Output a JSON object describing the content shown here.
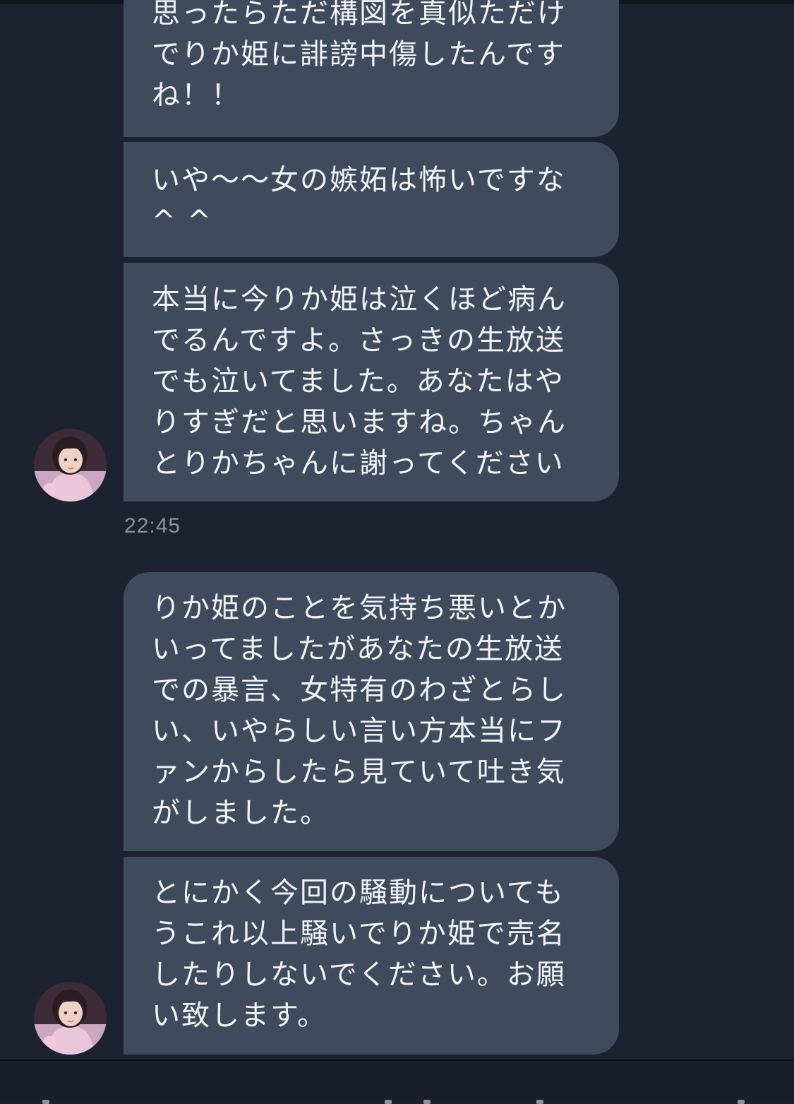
{
  "theme": {
    "background": "#1c2230",
    "bubble": "#3f4a5d",
    "text": "#f1f3f6",
    "timestamp": "#8a93a2"
  },
  "messages": [
    {
      "text": "思ったらただ構図を真似ただけ\nでりか姫に誹謗中傷したんです\nね！！"
    },
    {
      "text": "いや〜〜女の嫉妬は怖いですな\n^ ^"
    },
    {
      "text": "本当に今りか姫は泣くほど病ん\nでるんですよ。さっきの生放送\nでも泣いてました。あなたはや\nりすぎだと思いますね。ちゃん\nとりかちゃんに謝ってください"
    },
    {
      "text": "りか姫のことを気持ち悪いとか\nいってましたがあなたの生放送\nでの暴言、女特有のわざとらし\nい、いやらしい言い方本当にフ\nァンからしたら見ていて吐き気\nがしました。"
    },
    {
      "text": "とにかく今回の騒動についても\nうこれ以上騒いでりか姫で売名\nしたりしないでください。お願\nい致します。"
    }
  ],
  "timestamp": "22:45",
  "avatar_icon": "user-avatar-icon"
}
